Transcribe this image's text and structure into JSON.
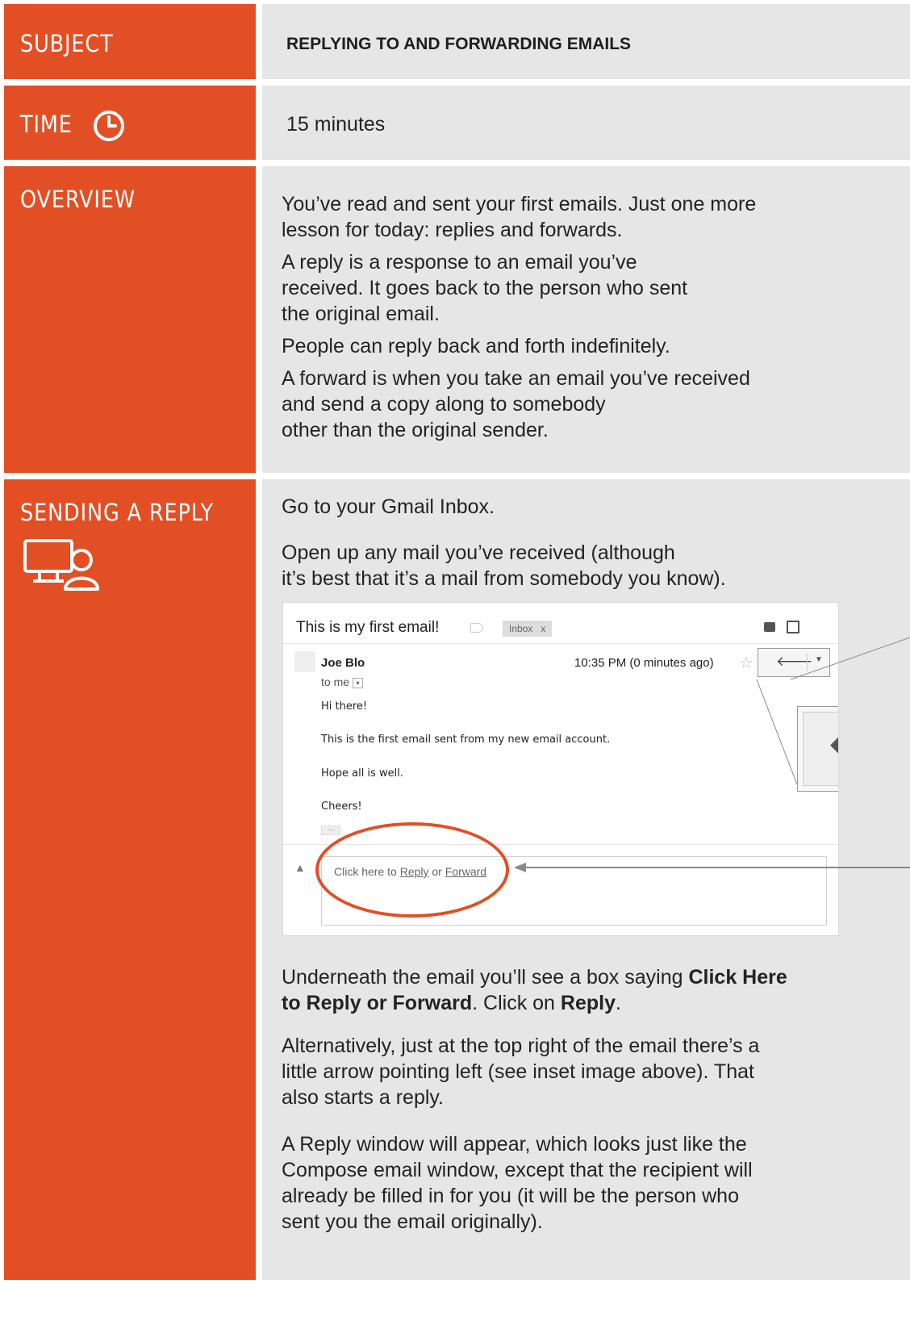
{
  "rows": {
    "subject": {
      "label": "SUBJECT",
      "value": "REPLYING TO AND FORWARDING EMAILS"
    },
    "time": {
      "label": "TIME",
      "icon": "clock-icon",
      "value": "15 minutes"
    },
    "overview": {
      "label": "OVERVIEW",
      "paragraphs": [
        [
          "You’ve read and sent your first emails. Just one more",
          "lesson for today: replies and forwards."
        ],
        [
          "A reply is a response to an email you’ve",
          "received. It goes back to the person who sent",
          "the original email."
        ],
        [
          "People can reply back and forth indefinitely."
        ],
        [
          "A forward is when you take an email you’ve received",
          "and send a copy along to somebody",
          "other than the original sender."
        ]
      ]
    },
    "sending_reply": {
      "label": "SENDING A REPLY",
      "icon": "computer-user-icon",
      "step1": "Go to your Gmail Inbox.",
      "step2": [
        "Open up any mail you’ve received (although",
        "it’s best that it’s a mail from somebody you know)."
      ],
      "after_para1": {
        "line1_text": "Underneath the email you’ll see a box saying ",
        "line1_bold": "Click Here",
        "line2_bold": "to Reply or Forward",
        "line2_mid": ". Click on ",
        "line2_bold2": "Reply",
        "line2_end": "."
      },
      "after_para2": [
        "Alternatively, just at the top right of the email there’s a",
        "little arrow pointing left (see inset image above). That",
        "also starts a reply."
      ],
      "after_para3": [
        "A Reply window will appear, which looks just like the",
        "Compose email window, except that the recipient will",
        "already be filled in for you (it will be the person who",
        "sent you the email originally)."
      ]
    }
  },
  "email_screenshot": {
    "subject": "This is my first email!",
    "inbox_tag": "Inbox",
    "inbox_tag_close": "x",
    "sender": "Joe Blo",
    "to": "to me",
    "time": "10:35 PM (0 minutes ago)",
    "body": [
      "Hi there!",
      "This is the first email sent from my new email account.",
      "Hope all is well.",
      "Cheers!"
    ],
    "dots": "···",
    "reply_prefix": "Click here to ",
    "reply_link": "Reply",
    "reply_or": " or ",
    "forward_link": "Forward"
  },
  "colors": {
    "accent": "#e24f25",
    "panel": "#e6e6e6"
  }
}
